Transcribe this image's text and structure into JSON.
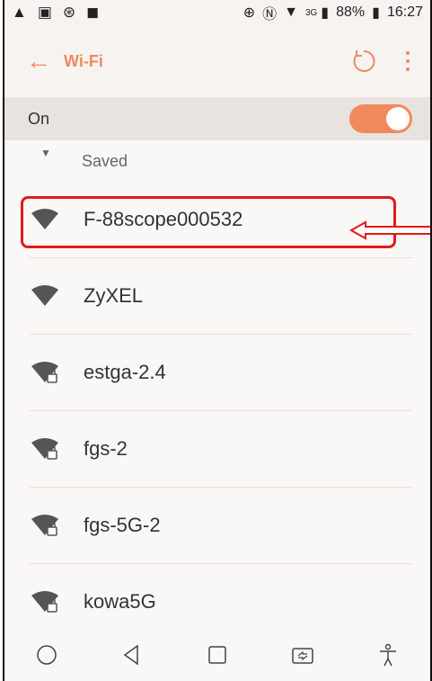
{
  "status_bar": {
    "time": "16:27",
    "battery_percent": "88%",
    "network": "3G",
    "icons": [
      "warning-icon",
      "gallery-icon",
      "accessibility-icon",
      "clipboard-icon",
      "circle-plus-icon",
      "nfc-icon",
      "wifi-status-icon",
      "signal-icon",
      "battery-icon"
    ]
  },
  "app_bar": {
    "title": "Wi-Fi",
    "back_icon": "back-arrow-icon",
    "refresh_icon": "refresh-icon",
    "menu_icon": "more-vert-icon"
  },
  "toggle_row": {
    "label": "On",
    "state": "on"
  },
  "list": {
    "saved_label": "Saved",
    "networks": [
      {
        "name": "F-88scope000532",
        "secured": false
      },
      {
        "name": "ZyXEL",
        "secured": false
      },
      {
        "name": "estga-2.4",
        "secured": true
      },
      {
        "name": "fgs-2",
        "secured": true
      },
      {
        "name": "fgs-5G-2",
        "secured": true
      },
      {
        "name": "kowa5G",
        "secured": true
      }
    ]
  },
  "colors": {
    "accent": "#f08a5d",
    "highlight": "#e11b1b",
    "text": "#333333",
    "background": "#faf8f7"
  },
  "nav_bar": {
    "icons": [
      "home-icon",
      "back-icon",
      "recents-icon",
      "screen-mirror-icon",
      "accessibility-nav-icon"
    ]
  }
}
